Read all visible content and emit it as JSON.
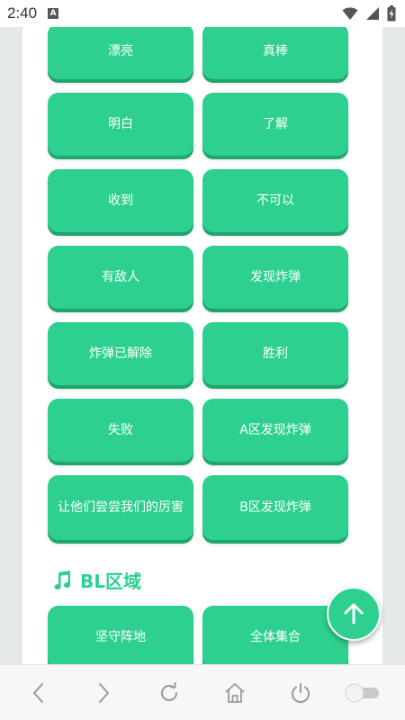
{
  "status_bar": {
    "time": "2:40",
    "notification_icon": "a-icon",
    "icons": [
      "wifi-icon",
      "signal-icon",
      "battery-charging-icon"
    ]
  },
  "buttons": [
    {
      "label": "漂亮"
    },
    {
      "label": "真棒"
    },
    {
      "label": "明白"
    },
    {
      "label": "了解"
    },
    {
      "label": "收到"
    },
    {
      "label": "不可以"
    },
    {
      "label": "有敌人"
    },
    {
      "label": "发现炸弹"
    },
    {
      "label": "炸弹已解除"
    },
    {
      "label": "胜利"
    },
    {
      "label": "失败"
    },
    {
      "label": "A区发现炸弹"
    },
    {
      "label": "让他们尝尝我们的厉害"
    },
    {
      "label": "B区发现炸弹"
    }
  ],
  "section": {
    "icon": "music-note-icon",
    "title": "BL区域"
  },
  "section_buttons": [
    {
      "label": "坚守阵地"
    },
    {
      "label": "全体集合"
    }
  ],
  "fab": {
    "icon": "arrow-up-icon"
  },
  "bottom_bar": {
    "items": [
      "back-icon",
      "forward-icon",
      "refresh-icon",
      "home-icon",
      "power-icon",
      "toggle-switch"
    ]
  },
  "colors": {
    "accent": "#2dd08e",
    "button_shadow": "#1fa56e",
    "page_bg": "#e4e9e7"
  }
}
